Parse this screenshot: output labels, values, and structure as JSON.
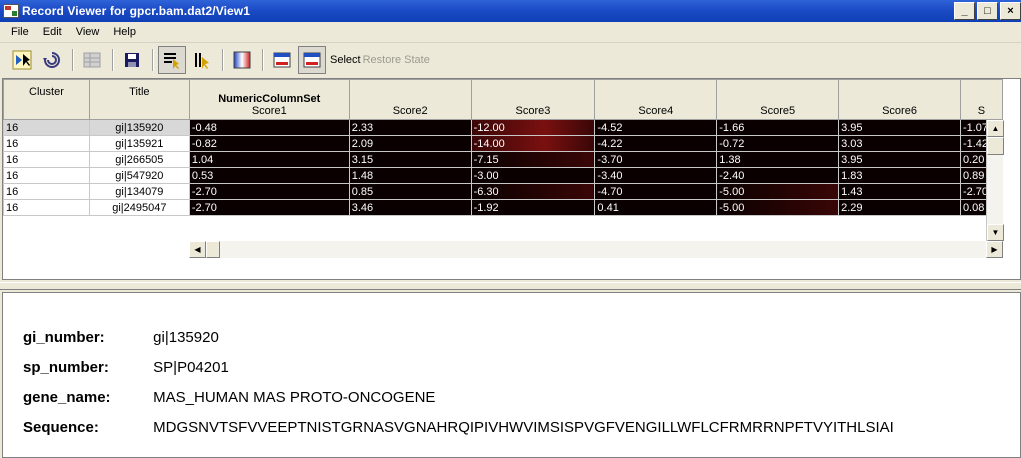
{
  "window": {
    "title": "Record Viewer for gpcr.bam.dat2/View1",
    "controls": [
      "_",
      "□",
      "×"
    ]
  },
  "menu": [
    "File",
    "Edit",
    "View",
    "Help"
  ],
  "toolbar": {
    "buttons": [
      "select-rows-icon",
      "refresh-icon",
      "grid-icon",
      "save-icon",
      "filter-select-icon",
      "brush-select-icon",
      "color-scale-icon",
      "window-icon",
      "select-state-icon"
    ],
    "select_label": "Select",
    "restore_label": "Restore State"
  },
  "grid": {
    "columns": {
      "cluster": "Cluster",
      "title": "Title",
      "set_name": "NumericColumnSet",
      "scores": [
        "Score1",
        "Score2",
        "Score3",
        "Score4",
        "Score5",
        "Score6",
        "S"
      ]
    },
    "rows": [
      {
        "cluster": "16",
        "title": "gi|135920",
        "scores": [
          "-0.48",
          "2.33",
          "-12.00",
          "-4.52",
          "-1.66",
          "3.95",
          "-1.07"
        ]
      },
      {
        "cluster": "16",
        "title": "gi|135921",
        "scores": [
          "-0.82",
          "2.09",
          "-14.00",
          "-4.22",
          "-0.72",
          "3.03",
          "-1.42"
        ]
      },
      {
        "cluster": "16",
        "title": "gi|266505",
        "scores": [
          "1.04",
          "3.15",
          "-7.15",
          "-3.70",
          "1.38",
          "3.95",
          "0.20"
        ]
      },
      {
        "cluster": "16",
        "title": "gi|547920",
        "scores": [
          "0.53",
          "1.48",
          "-3.00",
          "-3.40",
          "-2.40",
          "1.83",
          "0.89"
        ]
      },
      {
        "cluster": "16",
        "title": "gi|134079",
        "scores": [
          "-2.70",
          "0.85",
          "-6.30",
          "-4.70",
          "-5.00",
          "1.43",
          "-2.70"
        ]
      },
      {
        "cluster": "16",
        "title": "gi|2495047",
        "scores": [
          "-2.70",
          "3.46",
          "-1.92",
          "0.41",
          "-5.00",
          "2.29",
          "0.08"
        ]
      }
    ],
    "heat_colors": {
      "dark": "#0a0000",
      "mid": "#3a0606",
      "bright": "#7a1010"
    }
  },
  "detail": {
    "gi_number": {
      "label": "gi_number:",
      "value": "gi|135920"
    },
    "sp_number": {
      "label": "sp_number:",
      "value": "SP|P04201"
    },
    "gene_name": {
      "label": "gene_name:",
      "value": "MAS_HUMAN MAS PROTO-ONCOGENE"
    },
    "sequence": {
      "label": "Sequence:",
      "value": "MDGSNVTSFVVEEPTNISTGRNASVGNAHRQIPIVHWVIMSISPVGFVENGILLWFLCFRMRRNPFTVYITHLSIAI"
    }
  }
}
